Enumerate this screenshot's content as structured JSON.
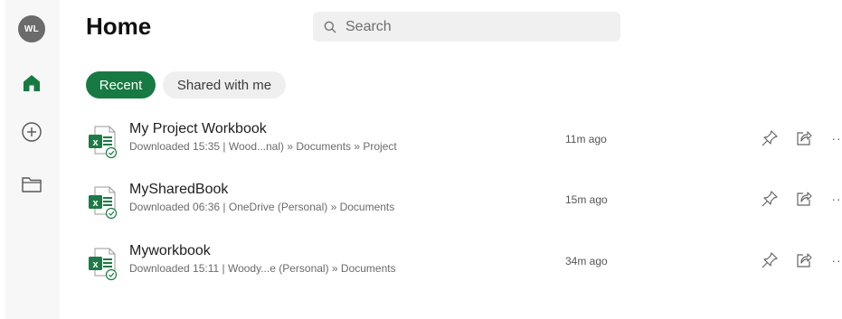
{
  "user": {
    "initials": "WL"
  },
  "nav": {
    "home_icon": "home-icon",
    "new_icon": "plus-circle-icon",
    "open_icon": "folder-icon"
  },
  "header": {
    "title": "Home",
    "search_placeholder": "Search"
  },
  "tabs": [
    {
      "label": "Recent",
      "active": true
    },
    {
      "label": "Shared with me",
      "active": false
    }
  ],
  "files": [
    {
      "name": "My Project Workbook",
      "path": "Downloaded 15:35 | Wood...nal) » Documents » Project",
      "time": "11m ago"
    },
    {
      "name": "MySharedBook",
      "path": "Downloaded 06:36 | OneDrive (Personal) » Documents",
      "time": "15m ago"
    },
    {
      "name": "Myworkbook",
      "path": "Downloaded 15:11 | Woody...e (Personal) » Documents",
      "time": "34m ago"
    }
  ],
  "colors": {
    "accent": "#177a42",
    "excel_green": "#1d7b45",
    "rail_bg": "#f7f7f7"
  }
}
